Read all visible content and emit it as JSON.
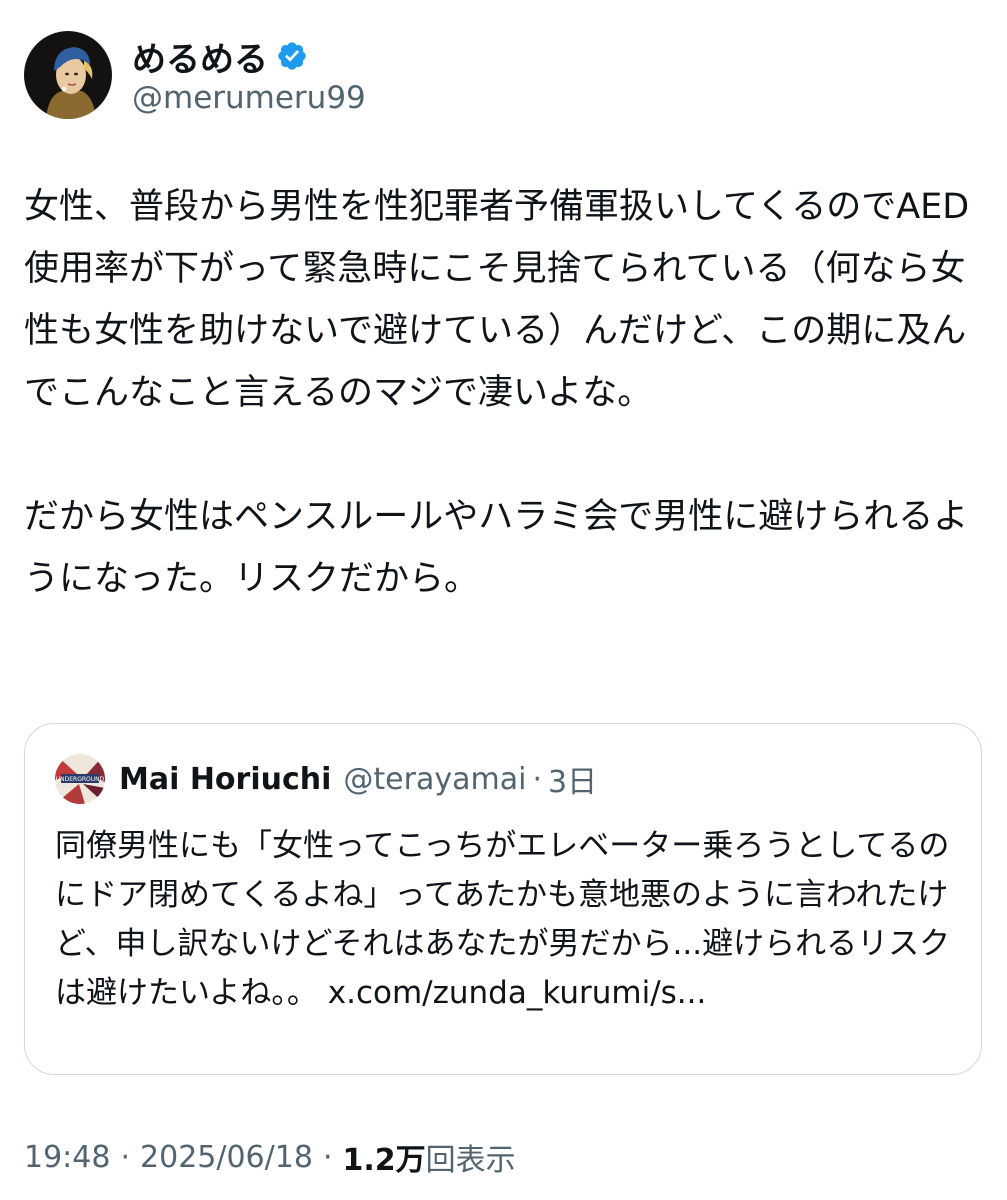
{
  "author": {
    "display_name": "めるめる",
    "handle": "@merumeru99",
    "avatar": "pearl-earring-portrait-avatar",
    "verified_icon": "verified-badge-icon",
    "verified_color": "#1d9bf0"
  },
  "tweet": {
    "paragraph_1": "女性、普段から男性を性犯罪者予備軍扱いしてくるのでAED使用率が下がって緊急時にこそ見捨てられている（何なら女性も女性を助けないで避けている）んだけど、この期に及んでこんなこと言えるのマジで凄いよな。",
    "paragraph_2": "だから女性はペンスルールやハラミ会で男性に避けられるようになった。リスクだから。"
  },
  "quote": {
    "avatar": "underground-logo-avatar",
    "avatar_label": "UNDERGROUND",
    "display_name": "Mai Horiuchi",
    "handle": "@terayamai",
    "separator": "·",
    "time": "3日",
    "text": "同僚男性にも「女性ってこっちがエレベーター乗ろうとしてるのにドア閉めてくるよね」ってあたかも意地悪のように言われたけど、申し訳ないけどそれはあなたが男だから...避けられるリスクは避けたいよね。。",
    "link_text": "x.com/zunda_kurumi/s..."
  },
  "meta": {
    "time": "19:48",
    "separator_1": "·",
    "date": "2025/06/18",
    "separator_2": "·",
    "views_count": "1.2万",
    "views_label": "回表示"
  },
  "colors": {
    "text_primary": "#0f1419",
    "text_secondary": "#536471",
    "border": "#cfd9de",
    "accent": "#1d9bf0"
  }
}
